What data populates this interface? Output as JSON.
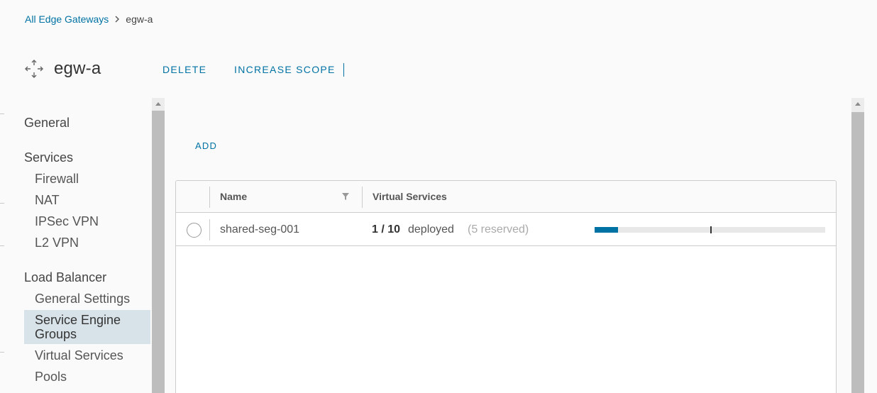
{
  "breadcrumb": {
    "parent": "All Edge Gateways",
    "current": "egw-a"
  },
  "header": {
    "icon": "edge-gateway-icon",
    "title": "egw-a",
    "actions": {
      "delete": "DELETE",
      "increase_scope": "INCREASE SCOPE"
    }
  },
  "sidebar": {
    "sections": [
      {
        "label": "General"
      },
      {
        "label": "Services",
        "items": [
          "Firewall",
          "NAT",
          "IPSec VPN",
          "L2 VPN"
        ]
      },
      {
        "label": "Load Balancer",
        "items": [
          "General Settings",
          "Service Engine Groups",
          "Virtual Services",
          "Pools"
        ]
      }
    ],
    "active_item": "Service Engine Groups"
  },
  "toolbar": {
    "add": "ADD"
  },
  "grid": {
    "columns": {
      "name": "Name",
      "virtual_services": "Virtual Services"
    },
    "rows": [
      {
        "name": "shared-seg-001",
        "vs_count": "1 / 10",
        "vs_status": "deployed",
        "vs_reserved": "(5 reserved)",
        "deployed_fraction": 0.1,
        "reserved_fraction": 0.5
      }
    ]
  },
  "colors": {
    "accent": "#0072a3",
    "active_bg": "#d8e3e9"
  }
}
